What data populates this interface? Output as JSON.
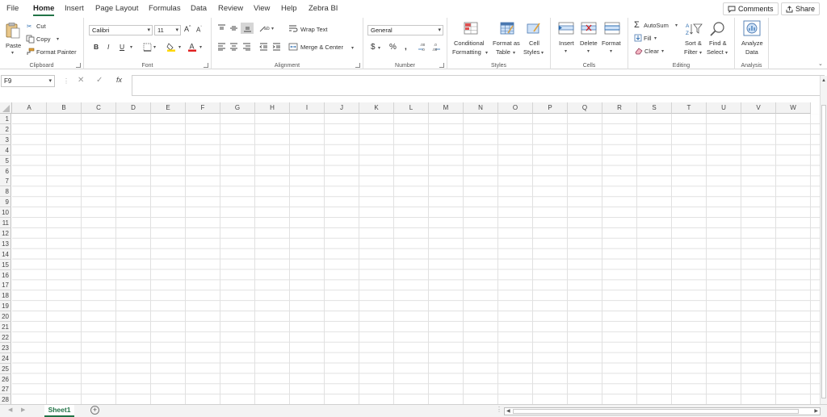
{
  "menu": {
    "tabs": [
      "File",
      "Home",
      "Insert",
      "Page Layout",
      "Formulas",
      "Data",
      "Review",
      "View",
      "Help",
      "Zebra BI"
    ],
    "comments": "Comments",
    "share": "Share"
  },
  "clipboard": {
    "paste": "Paste",
    "cut": "Cut",
    "copy": "Copy",
    "format_painter": "Format Painter",
    "label": "Clipboard"
  },
  "font": {
    "name": "Calibri",
    "size": "11",
    "bold": "B",
    "italic": "I",
    "underline": "U",
    "label": "Font"
  },
  "alignment": {
    "wrap_text": "Wrap Text",
    "merge_center": "Merge & Center",
    "label": "Alignment"
  },
  "number": {
    "format": "General",
    "label": "Number"
  },
  "styles": {
    "conditional_1": "Conditional",
    "conditional_2": "Formatting",
    "table_1": "Format as",
    "table_2": "Table",
    "cell_1": "Cell",
    "cell_2": "Styles",
    "label": "Styles"
  },
  "cells_group": {
    "insert": "Insert",
    "delete": "Delete",
    "format": "Format",
    "label": "Cells"
  },
  "editing": {
    "autosum": "AutoSum",
    "fill": "Fill",
    "clear": "Clear",
    "sort_1": "Sort &",
    "sort_2": "Filter",
    "find_1": "Find &",
    "find_2": "Select",
    "label": "Editing"
  },
  "analysis": {
    "analyze_1": "Analyze",
    "analyze_2": "Data",
    "label": "Analysis"
  },
  "formula_bar": {
    "cell_ref": "F9",
    "fx": "fx",
    "value": ""
  },
  "columns": [
    "A",
    "B",
    "C",
    "D",
    "E",
    "F",
    "G",
    "H",
    "I",
    "J",
    "K",
    "L",
    "M",
    "N",
    "O",
    "P",
    "Q",
    "R",
    "S",
    "T",
    "U",
    "V",
    "W"
  ],
  "rows": [
    "1",
    "2",
    "3",
    "4",
    "5",
    "6",
    "7",
    "8",
    "9",
    "10",
    "11",
    "12",
    "13",
    "14",
    "15",
    "16",
    "17",
    "18",
    "19",
    "20",
    "21",
    "22",
    "23",
    "24",
    "25",
    "26",
    "27",
    "28"
  ],
  "sheets": [
    "Sheet1"
  ],
  "colors": {
    "accent": "#217346"
  }
}
